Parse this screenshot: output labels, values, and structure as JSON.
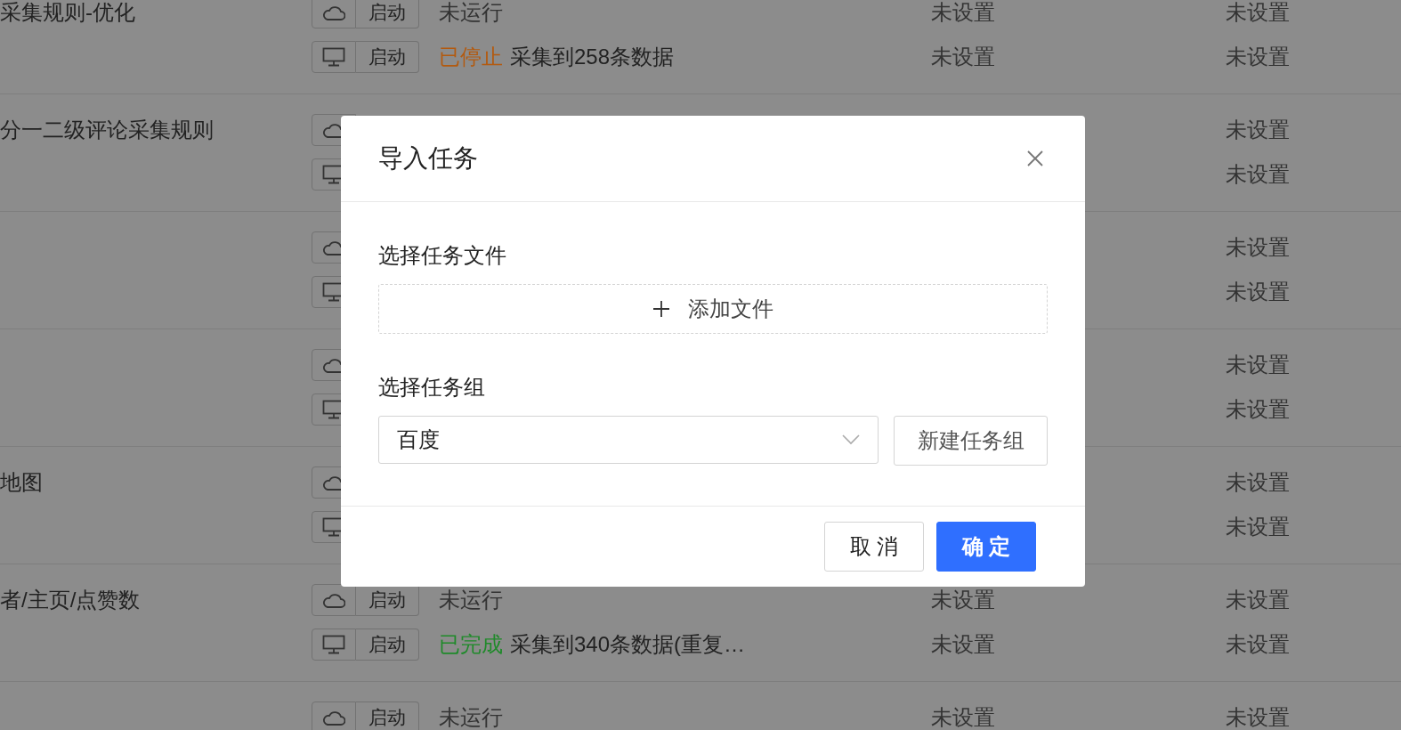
{
  "task_groups": [
    {
      "name": "采集规则-优化",
      "rows": [
        {
          "kind": "cloud",
          "button": "启动",
          "status": {
            "color": "#333333",
            "label": "未运行"
          },
          "column_3": "未设置",
          "column_4": "未设置"
        },
        {
          "kind": "local",
          "button": "启动",
          "status": {
            "color": "#b35a0f",
            "label": "已停止",
            "detail": "采集到258条数据"
          },
          "column_3": "未设置",
          "column_4": "未设置"
        }
      ]
    },
    {
      "name": "分一二级评论采集规则",
      "rows": [
        {
          "kind": "cloud",
          "column_4": "未设置"
        },
        {
          "kind": "local",
          "column_4": "未设置"
        }
      ]
    },
    {
      "rows": [
        {
          "kind": "cloud",
          "column_4": "未设置"
        },
        {
          "kind": "local",
          "column_4": "未设置"
        }
      ]
    },
    {
      "rows": [
        {
          "kind": "cloud",
          "column_4": "未设置"
        },
        {
          "kind": "local",
          "column_4": "未设置"
        }
      ]
    },
    {
      "name": "地图",
      "rows": [
        {
          "kind": "cloud",
          "column_4": "未设置"
        },
        {
          "kind": "local",
          "column_4": "未设置"
        }
      ]
    },
    {
      "name": "者/主页/点赞数",
      "rows": [
        {
          "kind": "cloud",
          "button": "启动",
          "status": {
            "color": "#333333",
            "label": "未运行"
          },
          "column_3": "未设置",
          "column_4": "未设置"
        },
        {
          "kind": "local",
          "button": "启动",
          "status": {
            "color": "#1f8a2a",
            "label": "已完成",
            "detail": "采集到340条数据(重复…"
          },
          "column_3": "未设置",
          "column_4": "未设置"
        }
      ]
    },
    {
      "rows": [
        {
          "kind": "cloud",
          "button": "启动",
          "status": {
            "color": "#333333",
            "label": "未运行"
          },
          "column_3": "未设置",
          "column_4": "未设置"
        }
      ]
    }
  ],
  "dialog": {
    "title": "导入任务",
    "file_label": "选择任务文件",
    "add_file_button": "添加文件",
    "group_label": "选择任务组",
    "group_select": {
      "value": "百度"
    },
    "new_group_button": "新建任务组",
    "buttons": [
      {
        "label": "取 消",
        "kind": "secondary"
      },
      {
        "label": "确 定",
        "kind": "primary"
      }
    ]
  }
}
